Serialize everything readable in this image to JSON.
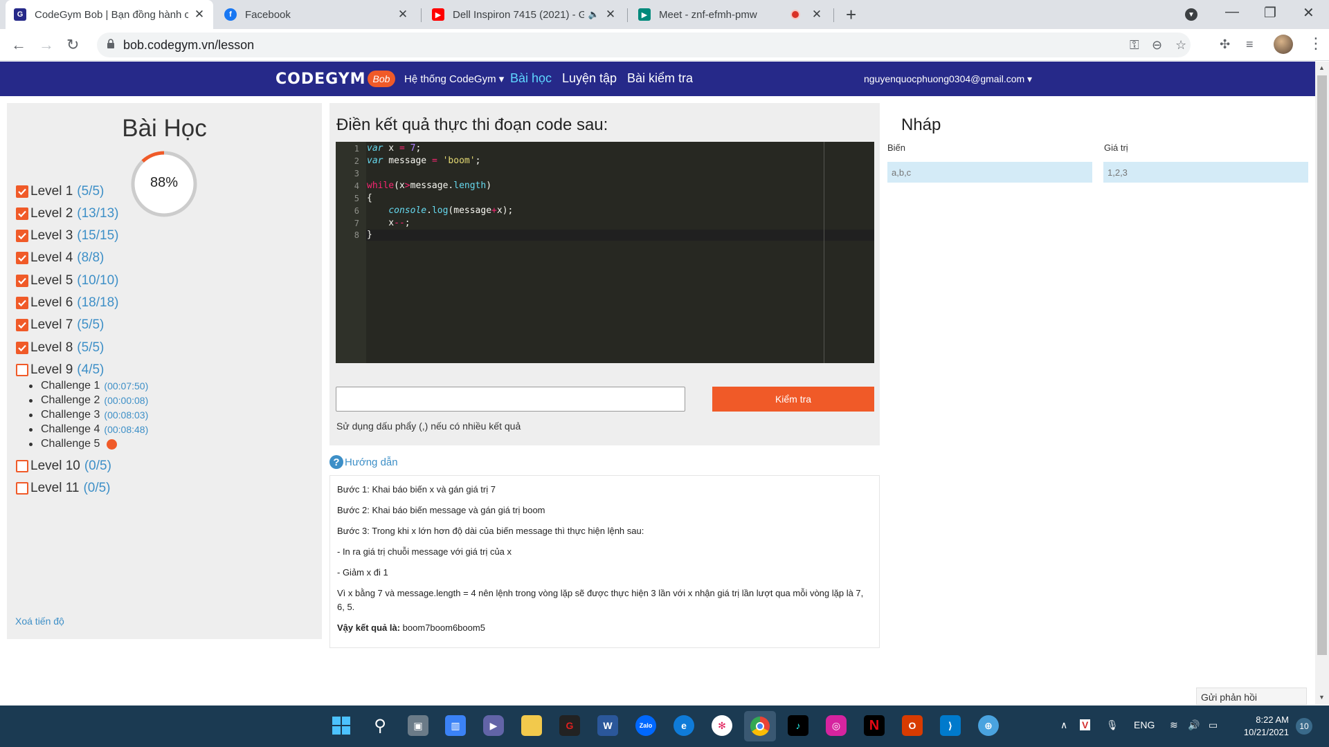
{
  "browser": {
    "tabs": [
      {
        "title": "CodeGym Bob | Bạn đồng hành c",
        "favicon": "codegym-icon"
      },
      {
        "title": "Facebook",
        "favicon": "facebook-icon"
      },
      {
        "title": "Dell Inspiron 7415 (2021) - G",
        "favicon": "youtube-icon"
      },
      {
        "title": "Meet - znf-efmh-pmw",
        "favicon": "meet-icon"
      }
    ],
    "url": "bob.codegym.vn/lesson"
  },
  "header": {
    "logo_text": "CODEGYM",
    "logo_badge": "Bob",
    "nav_system": "Hệ thống CodeGym ▾",
    "nav_lessons": "Bài học",
    "nav_practice": "Luyện tập",
    "nav_tests": "Bài kiểm tra",
    "user": "nguyenquocphuong0304@gmail.com ▾"
  },
  "left": {
    "title": "Bài Học",
    "progress_text": "88%",
    "progress": 0.88,
    "levels": [
      {
        "name": "Level 1",
        "count": "(5/5)",
        "done": true
      },
      {
        "name": "Level 2",
        "count": "(13/13)",
        "done": true
      },
      {
        "name": "Level 3",
        "count": "(15/15)",
        "done": true
      },
      {
        "name": "Level 4",
        "count": "(8/8)",
        "done": true
      },
      {
        "name": "Level 5",
        "count": "(10/10)",
        "done": true
      },
      {
        "name": "Level 6",
        "count": "(18/18)",
        "done": true
      },
      {
        "name": "Level 7",
        "count": "(5/5)",
        "done": true
      },
      {
        "name": "Level 8",
        "count": "(5/5)",
        "done": true
      },
      {
        "name": "Level 9",
        "count": "(4/5)",
        "done": false
      },
      {
        "name": "Level 10",
        "count": "(0/5)",
        "done": false
      },
      {
        "name": "Level 11",
        "count": "(0/5)",
        "done": false
      }
    ],
    "challenges": [
      {
        "name": "Challenge 1",
        "time": "(00:07:50)"
      },
      {
        "name": "Challenge 2",
        "time": "(00:00:08)"
      },
      {
        "name": "Challenge 3",
        "time": "(00:08:03)"
      },
      {
        "name": "Challenge 4",
        "time": "(00:08:48)"
      },
      {
        "name": "Challenge 5",
        "time": ""
      }
    ],
    "reset": "Xoá tiến độ"
  },
  "center": {
    "question": "Điền kết quả thực thi đoạn code sau:",
    "code_lines": [
      "1",
      "2",
      "3",
      "4",
      "5",
      "6",
      "7",
      "8"
    ],
    "answer_value": "",
    "check_label": "Kiểm tra",
    "hint": "Sử dụng dấu phẩy (,) nếu có nhiều kết quả",
    "guide_label": "Hướng dẫn",
    "guide": {
      "s1": "Bước 1: Khai báo biến x và gán giá trị 7",
      "s2": "Bước 2: Khai báo biến message và gán giá trị boom",
      "s3": "Bước 3: Trong khi x lớn hơn độ dài của biến message thì thực hiện lệnh sau:",
      "s4": "- In ra giá trị chuỗi message với giá trị của x",
      "s5": "- Giảm x đi 1",
      "s6": "Vì x bằng 7 và message.length = 4 nên lệnh trong vòng lặp sẽ được thực hiện 3 lần với x nhận giá trị lần lượt qua mỗi vòng lặp là 7, 6, 5.",
      "result_label": "Vậy kết quả là:",
      "result_value": "boom7boom6boom5"
    }
  },
  "right": {
    "title": "Nháp",
    "col_var": "Biến",
    "col_val": "Giá trị",
    "var_placeholder": "a,b,c",
    "val_placeholder": "1,2,3"
  },
  "feedback": "Gửi phản hồi",
  "taskbar": {
    "lang": "ENG",
    "time": "8:22 AM",
    "date": "10/21/2021",
    "notifications": "10"
  }
}
